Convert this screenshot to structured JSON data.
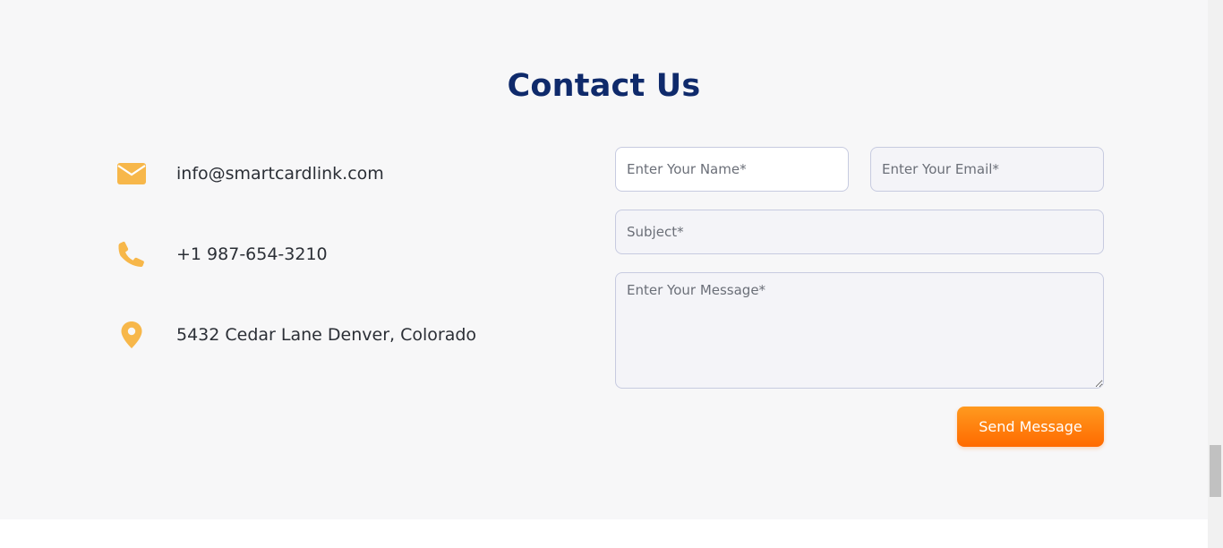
{
  "section": {
    "title": "Contact Us"
  },
  "contact_info": {
    "email": {
      "icon": "envelope-icon",
      "text": "info@smartcardlink.com"
    },
    "phone": {
      "icon": "phone-icon",
      "text": "+1 987-654-3210"
    },
    "address": {
      "icon": "location-pin-icon",
      "text": "5432 Cedar Lane Denver, Colorado"
    }
  },
  "form": {
    "name_placeholder": "Enter Your Name*",
    "email_placeholder": "Enter Your Email*",
    "subject_placeholder": "Subject*",
    "message_placeholder": "Enter Your Message*",
    "submit_label": "Send Message"
  },
  "colors": {
    "accent": "#f7b74a",
    "title": "#0f2a6b",
    "button": "#ff7a0a"
  }
}
